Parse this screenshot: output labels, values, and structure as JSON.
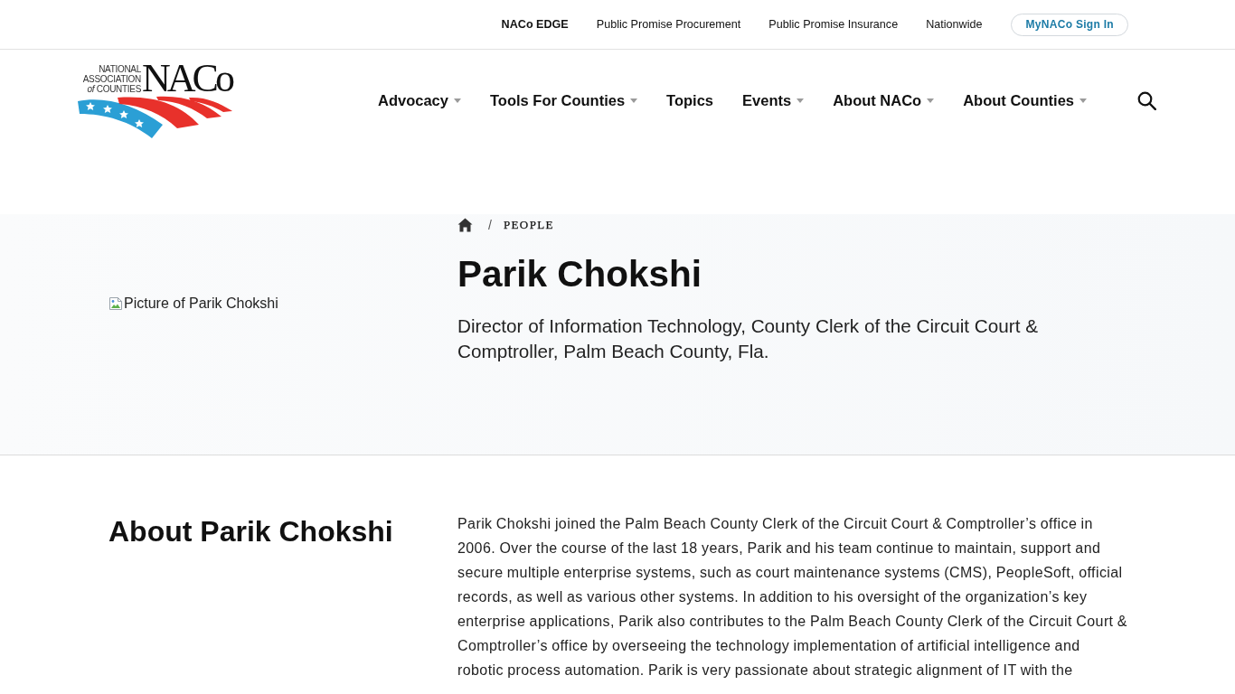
{
  "top_bar": {
    "links": [
      {
        "label": "NACo EDGE",
        "emphasized": true
      },
      {
        "label": "Public Promise Procurement",
        "emphasized": false
      },
      {
        "label": "Public Promise Insurance",
        "emphasized": false
      },
      {
        "label": "Nationwide",
        "emphasized": false
      }
    ],
    "sign_in_button": "MyNACo Sign In"
  },
  "logo": {
    "tagline_lines": [
      "NATIONAL",
      "ASSOCIATION",
      "*of* COUNTIES"
    ],
    "wordmark": "NACo"
  },
  "main_nav": {
    "items": [
      {
        "label": "Advocacy",
        "has_dropdown": true
      },
      {
        "label": "Tools For Counties",
        "has_dropdown": true
      },
      {
        "label": "Topics",
        "has_dropdown": false
      },
      {
        "label": "Events",
        "has_dropdown": true
      },
      {
        "label": "About NACo",
        "has_dropdown": true
      },
      {
        "label": "About Counties",
        "has_dropdown": true
      }
    ]
  },
  "profile_header": {
    "breadcrumb": {
      "separator": "/",
      "items": [
        "PEOPLE"
      ]
    },
    "photo_alt": "Picture of Parik Chokshi",
    "name": "Parik Chokshi",
    "title": "Director of Information Technology, County Clerk of the Circuit Court & Comptroller, Palm Beach County, Fla."
  },
  "about": {
    "heading": "About Parik Chokshi",
    "bio": "Parik Chokshi joined the Palm Beach County Clerk of the Circuit Court & Comptroller’s office in 2006. Over the course of the last 18 years, Parik and his team continue to maintain, support and secure multiple enterprise systems, such as court maintenance systems (CMS), PeopleSoft, official records, as well as various other systems. In addition to his oversight of the organization’s key enterprise applications, Parik also contributes to the Palm Beach County Clerk of the Circuit Court & Comptroller’s office by overseeing the technology implementation of artificial intelligence and robotic process automation. Parik is very passionate about strategic alignment of IT with the"
  }
}
